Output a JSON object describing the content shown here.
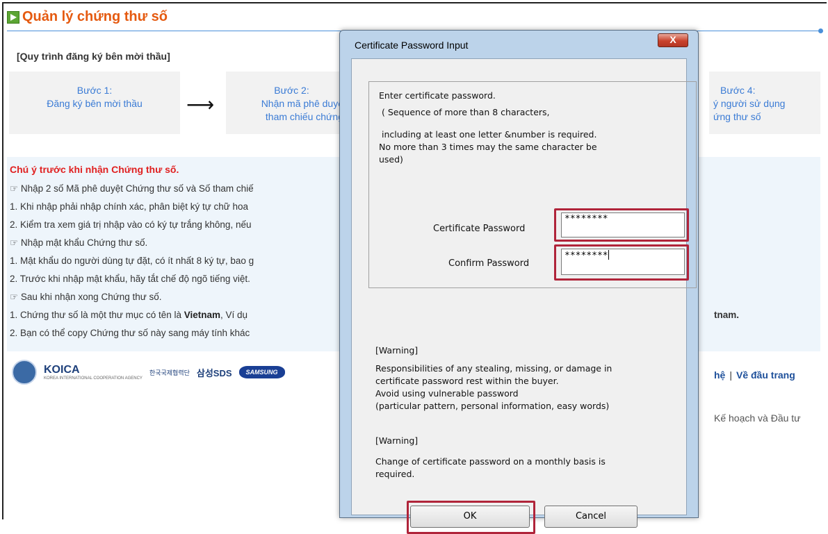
{
  "page": {
    "title": "Quản lý chứng thư số",
    "process_title": "[Quy trình đăng ký bên mời thầu]",
    "steps": [
      {
        "label": "Bước 1:",
        "text": "Đăng ký bên mời thầu"
      },
      {
        "label": "Bước 2:",
        "line1": "Nhận mã phê duyệ",
        "line2": "tham chiếu chứng"
      },
      {
        "label": "Bước 4:",
        "line1": "ý người sử dụng",
        "line2": "ứng thư số"
      }
    ],
    "step_arrow": "⟶",
    "notice": {
      "title": "Chú ý trước khi nhận Chứng thư số.",
      "lines": [
        "☞ Nhập 2 số Mã phê duyệt Chứng thư số và Số tham chiế",
        " 1. Khi nhập phải nhập chính xác, phân biệt ký tự chữ hoa",
        " 2. Kiểm tra xem giá trị nhập vào có ký tự trắng không, nếu",
        "☞ Nhập mật khẩu Chứng thư số.",
        " 1. Mật khẩu do người dùng tự đặt, có ít nhất 8 ký tự, bao g",
        " 2. Trước khi nhập mật khẩu, hãy tắt chế độ ngõ tiếng việt.",
        "☞ Sau khi nhận xong Chứng thư số.",
        " 1. Chứng thư số là một thư mục có tên là ",
        " 2. Bạn có thể copy Chứng thư số này sang máy tính khác"
      ],
      "bold_vietnam": "Vietnam",
      "line7_tail": ", Ví dụ",
      "right_tail": "tnam."
    },
    "footer": {
      "koica": "KOICA",
      "koica_sub": "KOREA INTERNATIONAL COOPERATION AGENCY",
      "korean": "한국국제협력단",
      "sds": "삼성SDS",
      "samsung": "SAMSUNG",
      "link_contact": "hệ",
      "separator": "|",
      "link_top": "Về đầu trang",
      "ministry": "Kế hoạch và Đầu tư"
    }
  },
  "dialog": {
    "title": "Certificate Password Input",
    "close_label": "X",
    "instructions": [
      "Enter certificate password.",
      "( Sequence of more than 8 characters,",
      "including at   least one letter &number is required.",
      "No more than  3 times may the same character be",
      "used)"
    ],
    "password_label": "Certificate Password",
    "password_value": "********",
    "confirm_label": "Confirm Password",
    "confirm_value": "********",
    "warning1_title": "[Warning]",
    "warning1_lines": [
      "Responsibilities of  any stealing, missing, or damage in",
      "certificate password rest within the buyer.",
      "Avoid using vulnerable password",
      "(particular pattern, personal information, easy words)"
    ],
    "warning2_title": "[Warning]",
    "warning2_lines": [
      "Change of certificate password on a monthly basis is",
      "required."
    ],
    "ok_label": "OK",
    "cancel_label": "Cancel"
  }
}
